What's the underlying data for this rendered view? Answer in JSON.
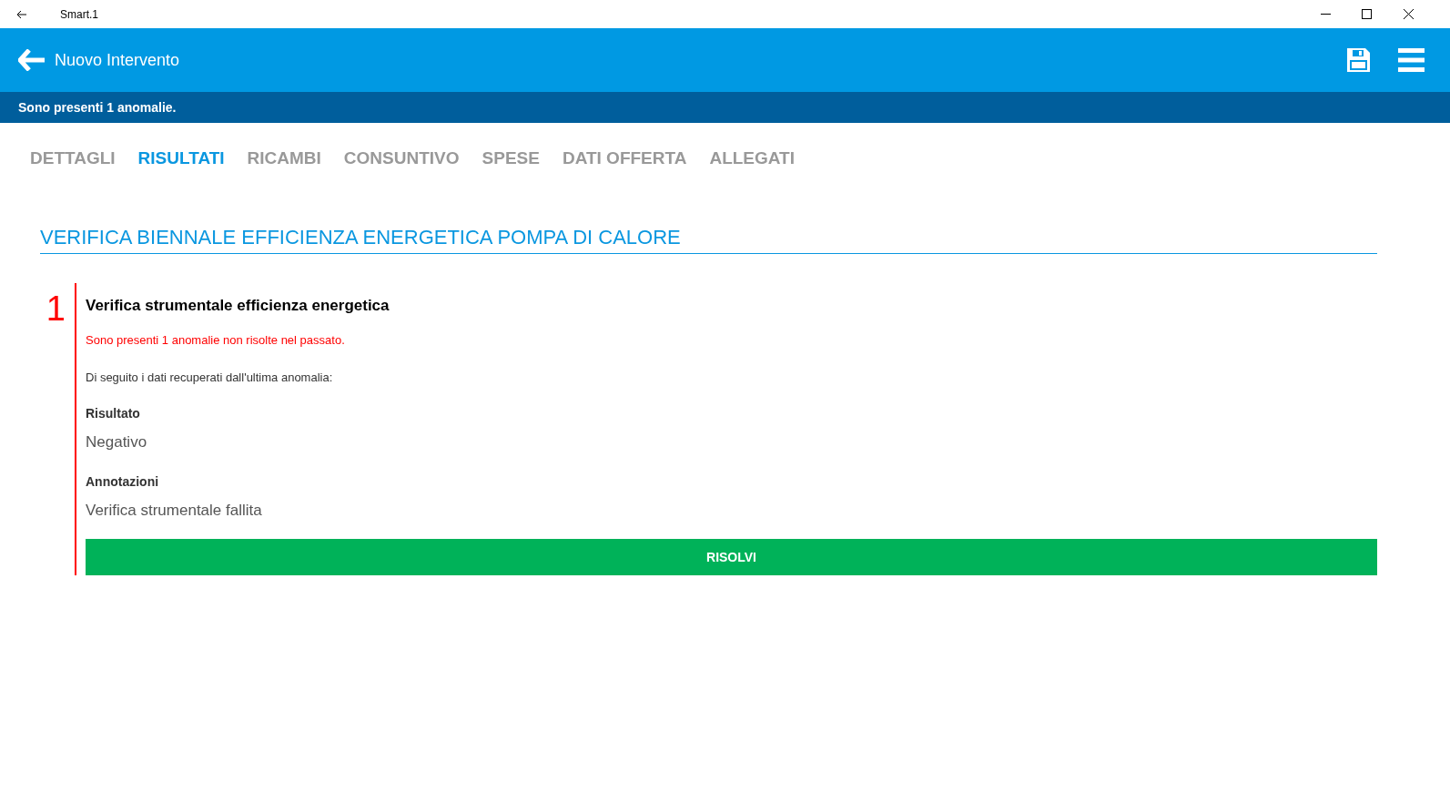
{
  "window": {
    "title": "Smart.1"
  },
  "header": {
    "title": "Nuovo Intervento"
  },
  "banner": "Sono presenti 1 anomalie.",
  "tabs": [
    {
      "label": "DETTAGLI",
      "selected": false
    },
    {
      "label": "RISULTATI",
      "selected": true
    },
    {
      "label": "RICAMBI",
      "selected": false
    },
    {
      "label": "CONSUNTIVO",
      "selected": false
    },
    {
      "label": "SPESE",
      "selected": false
    },
    {
      "label": "DATI OFFERTA",
      "selected": false
    },
    {
      "label": "ALLEGATI",
      "selected": false
    }
  ],
  "section": {
    "title": "VERIFICA BIENNALE EFFICIENZA ENERGETICA POMPA DI CALORE",
    "items": [
      {
        "number": "1",
        "title": "Verifica strumentale efficienza energetica",
        "warning": "Sono presenti 1 anomalie non risolte nel passato.",
        "intro": "Di seguito i dati recuperati dall'ultima anomalia:",
        "fields": [
          {
            "label": "Risultato",
            "value": "Negativo"
          },
          {
            "label": "Annotazioni",
            "value": "Verifica strumentale fallita"
          }
        ],
        "button": "RISOLVI"
      }
    ]
  }
}
